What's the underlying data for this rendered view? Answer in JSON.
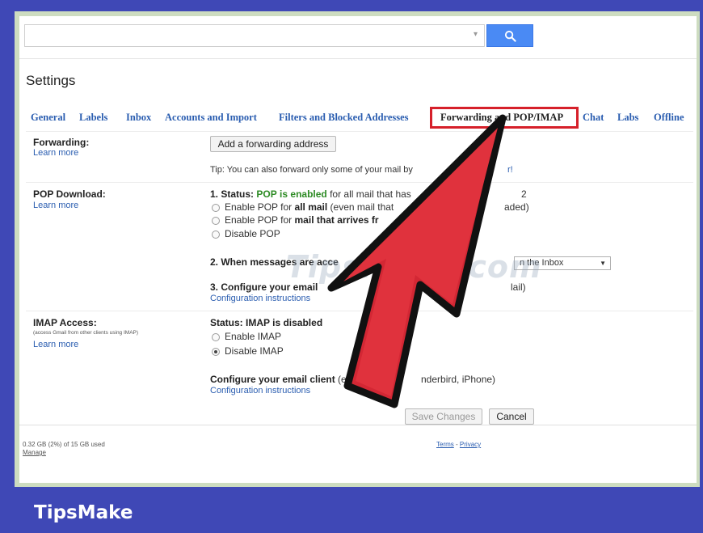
{
  "settings": {
    "title": "Settings"
  },
  "tabs": [
    {
      "label": "General"
    },
    {
      "label": "Labels"
    },
    {
      "label": "Inbox"
    },
    {
      "label": "Accounts and Import"
    },
    {
      "label": "Filters and Blocked Addresses"
    },
    {
      "label": "Forwarding and POP/IMAP"
    },
    {
      "label": "Chat"
    },
    {
      "label": "Labs"
    },
    {
      "label": "Offline"
    }
  ],
  "forwarding": {
    "label": "Forwarding:",
    "learn_more": "Learn more",
    "add_button": "Add a forwarding address",
    "tip": "Tip: You can also forward only some of your mail by",
    "tip_tail": "r!"
  },
  "pop": {
    "label": "POP Download:",
    "learn_more": "Learn more",
    "status_prefix": "1. Status:",
    "status_pop": "POP",
    "status_enabled": "is enabled",
    "status_tail": "for all mail that has",
    "status_end": "2",
    "opt1_a": "Enable POP for",
    "opt1_b": "all mail",
    "opt1_c": "(even mail that",
    "opt1_d": "aded)",
    "opt2_a": "Enable POP for",
    "opt2_b": "mail that arrives fr",
    "opt3": "Disable POP",
    "step2": "2. When messages are acce",
    "step2_select": "n the Inbox",
    "step3": "3. Configure your email",
    "step3_tail": "lail)",
    "config_link": "Configuration instructions"
  },
  "imap": {
    "label": "IMAP Access:",
    "sublabel": "(access Gmail from other clients using IMAP)",
    "learn_more": "Learn more",
    "status": "Status: IMAP is disabled",
    "opt_enable": "Enable IMAP",
    "opt_disable": "Disable IMAP",
    "configure_a": "Configure your email client",
    "configure_b": "(e.g",
    "configure_c": "nderbird, iPhone)",
    "config_link": "Configuration instructions"
  },
  "actions": {
    "save": "Save Changes",
    "cancel": "Cancel"
  },
  "footer": {
    "storage": "0.32 GB (2%) of 15 GB used",
    "manage": "Manage",
    "terms": "Terms",
    "separator": "-",
    "privacy": "Privacy"
  },
  "watermark": "TipsMake.com",
  "brand": "TipsMake",
  "colors": {
    "accent_red": "#d6202a",
    "link": "#2a5db0",
    "brand_bg": "#3f48b6",
    "pop_green": "#2d8b24"
  },
  "icons": {
    "search": "search-icon",
    "dropdown": "chevron-down-icon",
    "pointer": "arrow-pointer-icon"
  }
}
